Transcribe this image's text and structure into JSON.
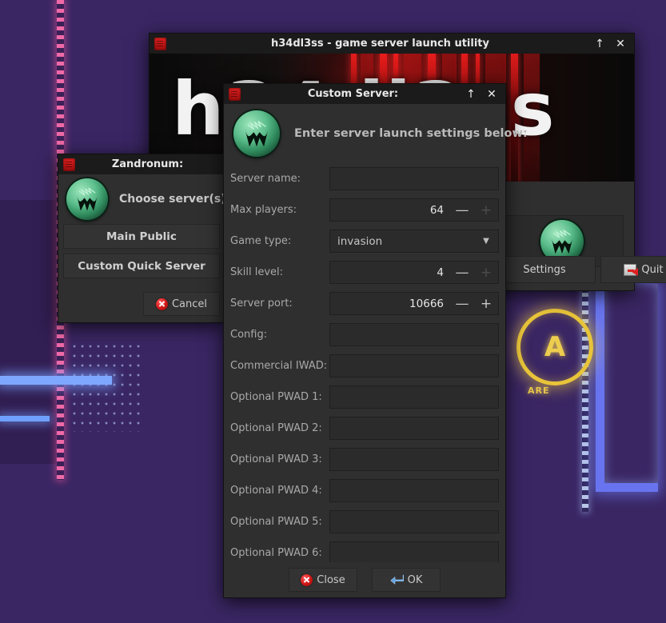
{
  "desktop": {
    "neon_sign_letter": "A",
    "neon_sign_caption": "ARE"
  },
  "main_window": {
    "title": "h34dl3ss - game server launch utility",
    "icon": "app-icon",
    "banner_text": "h34dl3ss",
    "titlebar_buttons": [
      {
        "name": "shade-button",
        "glyph": "↑"
      },
      {
        "name": "close-button",
        "glyph": "✕"
      }
    ],
    "buttons": [
      {
        "name": "settings-button",
        "label": "Settings",
        "icon": ""
      },
      {
        "name": "quit-button",
        "label": "Quit",
        "icon": "exit-icon"
      }
    ],
    "logo": "zandronum-logo"
  },
  "zandronum_dialog": {
    "title": "Zandronum:",
    "icon": "app-icon",
    "heading": "Choose server(s)",
    "logo": "zandronum-logo",
    "server_buttons": [
      {
        "name": "main-public-button",
        "label": "Main Public"
      },
      {
        "name": "custom-quick-server-button",
        "label": "Custom Quick Server"
      }
    ],
    "cancel": {
      "name": "cancel-button",
      "label": "Cancel",
      "icon": "red-x-icon"
    }
  },
  "custom_server_dialog": {
    "title": "Custom Server:",
    "icon": "app-icon",
    "heading": "Enter server launch settings below:",
    "logo": "zandronum-logo",
    "titlebar_buttons": [
      {
        "name": "shade-button",
        "glyph": "↑"
      },
      {
        "name": "close-button",
        "glyph": "✕"
      }
    ],
    "fields": [
      {
        "name": "server-name",
        "label": "Server name:",
        "type": "text",
        "value": ""
      },
      {
        "name": "max-players",
        "label": "Max players:",
        "type": "spin",
        "value": "64",
        "minus": "—",
        "plus": "+",
        "plus_disabled": true
      },
      {
        "name": "game-type",
        "label": "Game type:",
        "type": "select",
        "value": "invasion",
        "caret": "▼"
      },
      {
        "name": "skill-level",
        "label": "Skill level:",
        "type": "spin",
        "value": "4",
        "minus": "—",
        "plus": "+",
        "plus_disabled": true
      },
      {
        "name": "server-port",
        "label": "Server port:",
        "type": "spin",
        "value": "10666",
        "minus": "—",
        "plus": "+",
        "plus_disabled": false
      },
      {
        "name": "config",
        "label": "Config:",
        "type": "text",
        "value": ""
      },
      {
        "name": "commercial-iwad",
        "label": "Commercial IWAD:",
        "type": "text",
        "value": ""
      },
      {
        "name": "optional-pwad-1",
        "label": "Optional PWAD 1:",
        "type": "text",
        "value": ""
      },
      {
        "name": "optional-pwad-2",
        "label": "Optional PWAD 2:",
        "type": "text",
        "value": ""
      },
      {
        "name": "optional-pwad-3",
        "label": "Optional PWAD 3:",
        "type": "text",
        "value": ""
      },
      {
        "name": "optional-pwad-4",
        "label": "Optional PWAD 4:",
        "type": "text",
        "value": ""
      },
      {
        "name": "optional-pwad-5",
        "label": "Optional PWAD 5:",
        "type": "text",
        "value": ""
      },
      {
        "name": "optional-pwad-6",
        "label": "Optional PWAD 6:",
        "type": "text",
        "value": ""
      }
    ],
    "footer_buttons": [
      {
        "name": "close-button",
        "label": "Close",
        "icon": "red-x-icon"
      },
      {
        "name": "ok-button",
        "label": "OK",
        "icon": "enter-arrow-icon"
      }
    ]
  },
  "colors": {
    "window_bg": "#2f2f2f",
    "titlebar_bg": "#1b1b1b",
    "field_bg": "#2b2b2b",
    "label_fg": "#a9a9a9",
    "accent_red": "#d01616",
    "logo_green": "#2f8a5c"
  }
}
